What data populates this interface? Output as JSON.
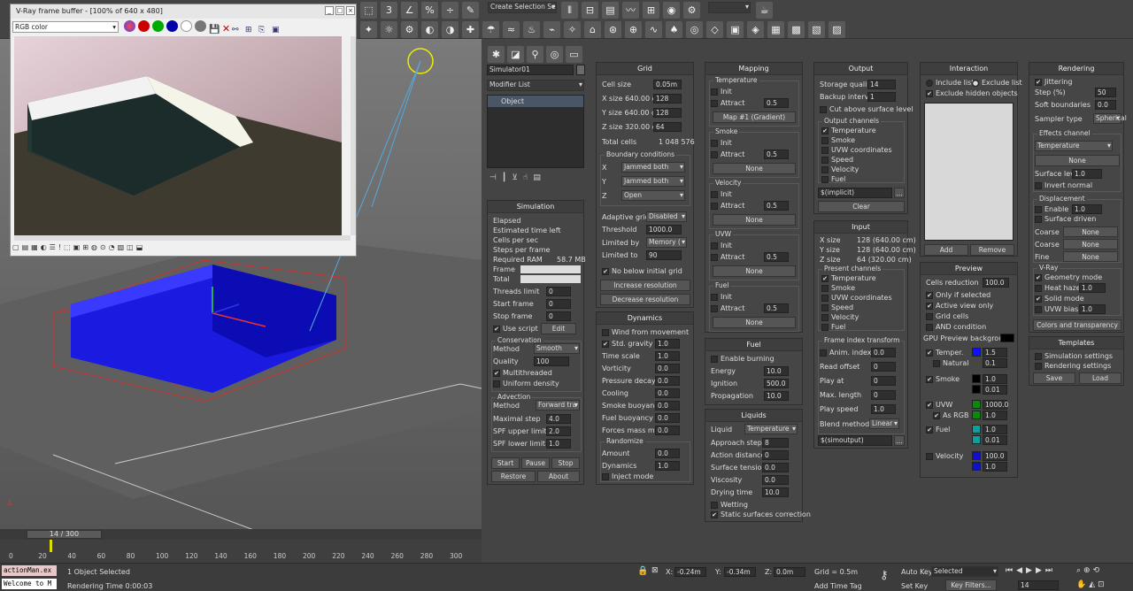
{
  "toolbar": {
    "selection_set": "Create Selection Se"
  },
  "vfb": {
    "title": "V-Ray frame buffer - [100% of 640 x 480]",
    "channel": "RGB color"
  },
  "viewport": {
    "timeline_pos": "14 / 300",
    "ticks": [
      "0",
      "20",
      "40",
      "60",
      "80",
      "100",
      "120",
      "140",
      "160",
      "180",
      "200",
      "220",
      "240",
      "260",
      "280",
      "300"
    ]
  },
  "modifier": {
    "name": "Simulator01",
    "list": "Modifier List",
    "item": "Object"
  },
  "simulation": {
    "title": "Simulation",
    "elapsed": "Elapsed",
    "eta": "Estimated time left",
    "cps": "Cells per sec",
    "sps": "Steps per frame",
    "ram_label": "Required RAM",
    "ram": "58.7 MB",
    "frame": "Frame",
    "total": "Total",
    "threads": "Threads limit",
    "threads_v": "0",
    "start": "Start frame",
    "start_v": "0",
    "stop": "Stop frame",
    "stop_v": "0",
    "use_script": "Use script",
    "edit": "Edit",
    "cons": "Conservation",
    "method": "Method",
    "smooth": "Smooth",
    "quality": "Quality",
    "quality_v": "100",
    "mt": "Multithreaded",
    "ud": "Uniform density",
    "adv": "Advection",
    "adv_m": "Method",
    "adv_v": "Forward tra",
    "maxstep": "Maximal step",
    "maxstep_v": "4.0",
    "spfu": "SPF upper limit",
    "spfu_v": "2.0",
    "spfl": "SPF lower limit",
    "spfl_v": "1.0",
    "b_start": "Start",
    "b_pause": "Pause",
    "b_stop": "Stop",
    "b_restore": "Restore",
    "b_about": "About"
  },
  "grid": {
    "title": "Grid",
    "cell": "Cell size",
    "cell_v": "0.05m",
    "xs": "X size",
    "xs_cm": "640.00 cm",
    "xs_v": "128",
    "ys": "Y size",
    "ys_cm": "640.00 cm",
    "ys_v": "128",
    "zs": "Z size",
    "zs_cm": "320.00 cm",
    "zs_v": "64",
    "tc": "Total cells",
    "tc_v": "1 048 576",
    "bc": "Boundary conditions",
    "bx": "X",
    "bx_v": "Jammed both",
    "by": "Y",
    "by_v": "Jammed both",
    "bz": "Z",
    "bz_v": "Open",
    "ag": "Adaptive grid",
    "ag_v": "Disabled",
    "th": "Threshold",
    "th_v": "1000.0",
    "lb": "Limited by",
    "lb_v": "Memory (",
    "lt": "Limited to",
    "lt_v": "90",
    "nbig": "No below initial grid",
    "inc": "Increase resolution",
    "dec": "Decrease resolution"
  },
  "dynamics": {
    "title": "Dynamics",
    "wind": "Wind from movement",
    "grav": "Std. gravity",
    "grav_v": "1.0",
    "ts": "Time scale",
    "ts_v": "1.0",
    "vort": "Vorticity",
    "vort_v": "0.0",
    "pd": "Pressure decay",
    "pd_v": "0.0",
    "cool": "Cooling",
    "cool_v": "0.0",
    "sb": "Smoke buoyancy",
    "sb_v": "0.0",
    "fb": "Fuel buoyancy",
    "fb_v": "0.0",
    "fmm": "Forces mass mult.",
    "fmm_v": "0.0",
    "rnd": "Randomize",
    "amt": "Amount",
    "amt_v": "0.0",
    "dyn": "Dynamics",
    "dyn_v": "1.0",
    "inj": "Inject mode"
  },
  "mapping": {
    "title": "Mapping",
    "temp": "Temperature",
    "smoke": "Smoke",
    "vel": "Velocity",
    "uvw": "UVW",
    "fuel": "Fuel",
    "init": "Init",
    "attract": "Attract",
    "attract_v": "0.5",
    "map1": "Map #1 (Gradient)",
    "none": "None"
  },
  "fuel": {
    "title": "Fuel",
    "eb": "Enable burning",
    "en": "Energy",
    "en_v": "10.0",
    "ig": "Ignition",
    "ig_v": "500.0",
    "pr": "Propagation",
    "pr_v": "10.0"
  },
  "liquids": {
    "title": "Liquids",
    "liq": "Liquid",
    "liq_v": "Temperature",
    "as": "Approach steps",
    "as_v": "8",
    "ad": "Action distance",
    "ad_v": "0",
    "st": "Surface tension",
    "st_v": "0.0",
    "visc": "Viscosity",
    "visc_v": "0.0",
    "dt": "Drying time",
    "dt_v": "10.0",
    "wet": "Wetting",
    "ssc": "Static surfaces correction"
  },
  "output": {
    "title": "Output",
    "sq": "Storage quality",
    "sq_v": "14",
    "bi": "Backup interval",
    "bi_v": "1",
    "cut": "Cut above surface level",
    "oc": "Output channels",
    "ch": [
      "Temperature",
      "Smoke",
      "UVW coordinates",
      "Speed",
      "Velocity",
      "Fuel"
    ],
    "path": "$(implicit)",
    "clear": "Clear"
  },
  "input": {
    "title": "Input",
    "xs": "X size",
    "xs_v": "128 (640.00 cm)",
    "ys": "Y size",
    "ys_v": "128 (640.00 cm)",
    "zs": "Z size",
    "zs_v": "64 (320.00 cm)",
    "pc": "Present channels",
    "ch": [
      "Temperature",
      "Smoke",
      "UVW coordinates",
      "Speed",
      "Velocity",
      "Fuel"
    ],
    "fit": "Frame index transform",
    "ai": "Anim. index",
    "ai_v": "0.0",
    "ro": "Read offset",
    "ro_v": "0",
    "pa": "Play at",
    "pa_v": "0",
    "ml": "Max. length",
    "ml_v": "0",
    "ps": "Play speed",
    "ps_v": "1.0",
    "bm": "Blend method",
    "bm_v": "Linear",
    "path": "$(simoutput)"
  },
  "interaction": {
    "title": "Interaction",
    "inc": "Include list",
    "exc": "Exclude list",
    "ehid": "Exclude hidden objects",
    "add": "Add",
    "remove": "Remove"
  },
  "preview": {
    "title": "Preview",
    "cr": "Cells reduction",
    "cr_v": "100.0",
    "os": "Only if selected",
    "avo": "Active view only",
    "gc": "Grid cells",
    "andc": "AND condition",
    "gpu": "GPU Preview background",
    "temper": "Temper.",
    "t1": "1.5",
    "nat": "Natural",
    "t2": "0.1",
    "smoke": "Smoke",
    "s1": "1.0",
    "s2": "0.01",
    "uvw": "UVW",
    "u1": "1000.0",
    "asrgb": "As RGB",
    "u2": "1.0",
    "fuel": "Fuel",
    "f1": "1.0",
    "f2": "0.01",
    "vel": "Velocity",
    "v1": "100.0",
    "v2": "1.0"
  },
  "rendering": {
    "title": "Rendering",
    "jit": "Jittering",
    "step": "Step (%)",
    "step_v": "50",
    "sb": "Soft boundaries",
    "sb_v": "0.0",
    "st": "Sampler type",
    "st_v": "Spherical",
    "ec": "Effects channel",
    "ec_v": "Temperature",
    "none": "None",
    "sl": "Surface level",
    "sl_v": "1.0",
    "inv": "Invert normal",
    "disp": "Displacement",
    "en": "Enable",
    "en_v": "1.0",
    "sd": "Surface driven",
    "coarse": "Coarse",
    "fine": "Fine",
    "vray": "V-Ray",
    "geo": "Geometry mode",
    "hh": "Heat haze",
    "hh_v": "1.0",
    "solid": "Solid mode",
    "uvwb": "UVW bias",
    "uvwb_v": "1.0",
    "cat": "Colors and transparency"
  },
  "templates": {
    "title": "Templates",
    "ss": "Simulation settings",
    "rs": "Rendering settings",
    "save": "Save",
    "load": "Load"
  },
  "status": {
    "script": "actionMan.ex",
    "welcome": "Welcome to M",
    "sel": "1 Object Selected",
    "rt": "Rendering Time  0:00:03",
    "x": "-0.24m",
    "y": "-0.34m",
    "z": "0.0m",
    "grid": "Grid = 0.5m",
    "addtag": "Add Time Tag",
    "autokey": "Auto Key",
    "setkey": "Set Key",
    "selected": "Selected",
    "kf": "Key Filters...",
    "frame": "14"
  }
}
